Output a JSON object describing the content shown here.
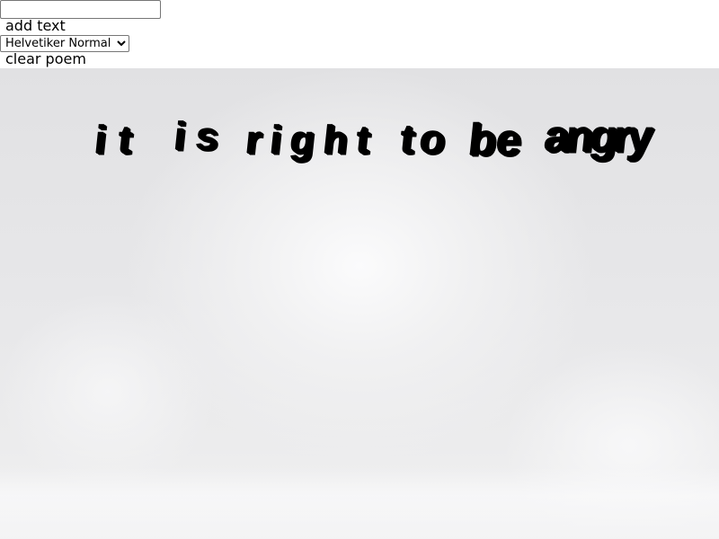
{
  "controls": {
    "text_input": {
      "value": "",
      "placeholder": ""
    },
    "add_text_label": "add text",
    "font_select": {
      "selected": "Helvetiker Normal",
      "options": [
        "Helvetiker Normal"
      ]
    },
    "clear_poem_label": "clear poem"
  },
  "stage": {
    "poem_words": [
      "it",
      "is",
      "right",
      "to",
      "be",
      "angry"
    ]
  },
  "colors": {
    "text_3d": "#000000",
    "stage_bg": "#e6e6e8"
  }
}
